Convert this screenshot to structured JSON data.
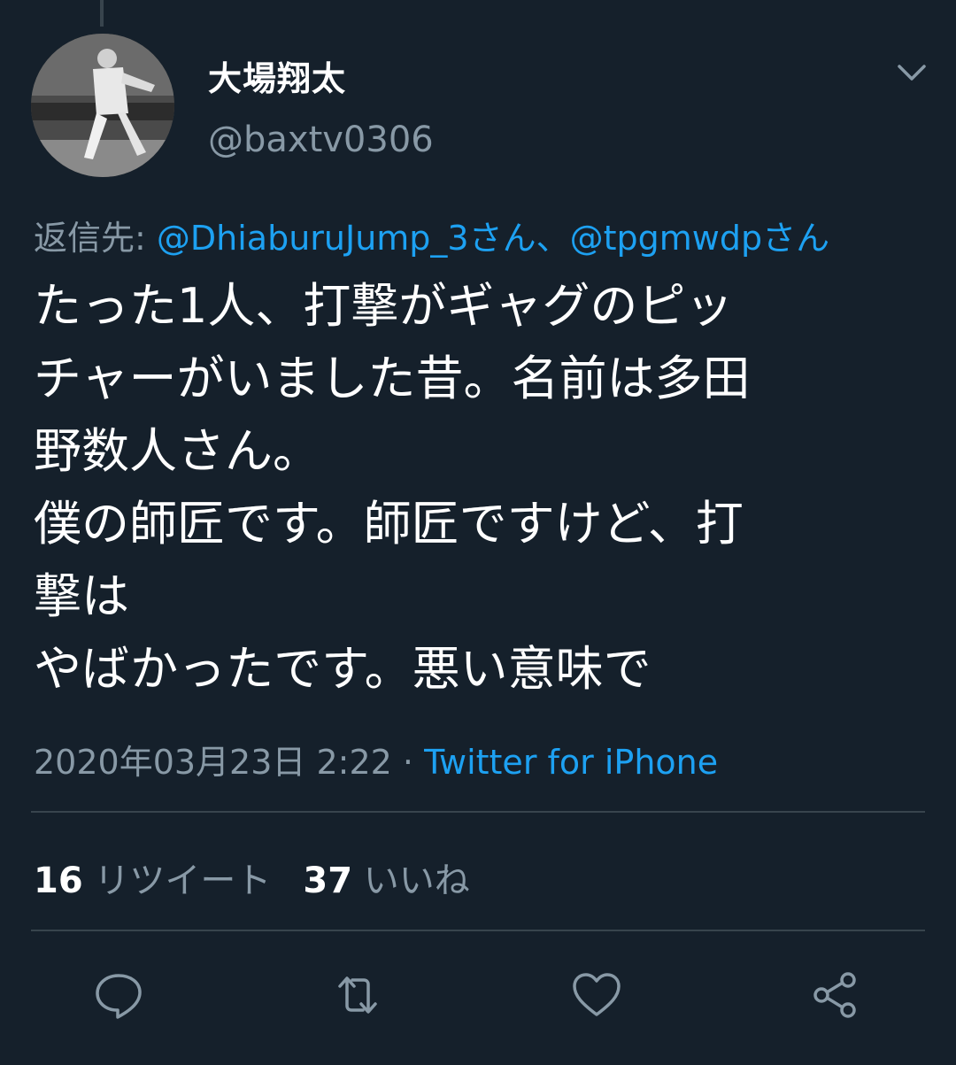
{
  "tweet": {
    "display_name": "大場翔太",
    "handle": "@baxtv0306",
    "reply_prefix": "返信先: ",
    "reply_mention_1": "@DhiaburuJump_3さん",
    "reply_separator": "、",
    "reply_mention_2": "@tpgmwdpさん",
    "body_lines": [
      "たった1人、打撃がギャグのピッ",
      "チャーがいました昔。名前は多田",
      "野数人さん。",
      "僕の師匠です。師匠ですけど、打",
      "撃は",
      "やばかったです。悪い意味で"
    ],
    "timestamp": "2020年03月23日 2:22",
    "meta_separator": " · ",
    "source": "Twitter for iPhone"
  },
  "stats": {
    "retweets_count": "16",
    "retweets_label": "リツイート",
    "likes_count": "37",
    "likes_label": "いいね"
  },
  "icons": {
    "caret": "chevron-down-icon",
    "reply": "reply-icon",
    "retweet": "retweet-icon",
    "like": "heart-icon",
    "share": "share-icon"
  },
  "colors": {
    "background": "#15202b",
    "accent": "#1da1f2",
    "secondary_text": "#8899a6",
    "divider": "#38444d"
  }
}
